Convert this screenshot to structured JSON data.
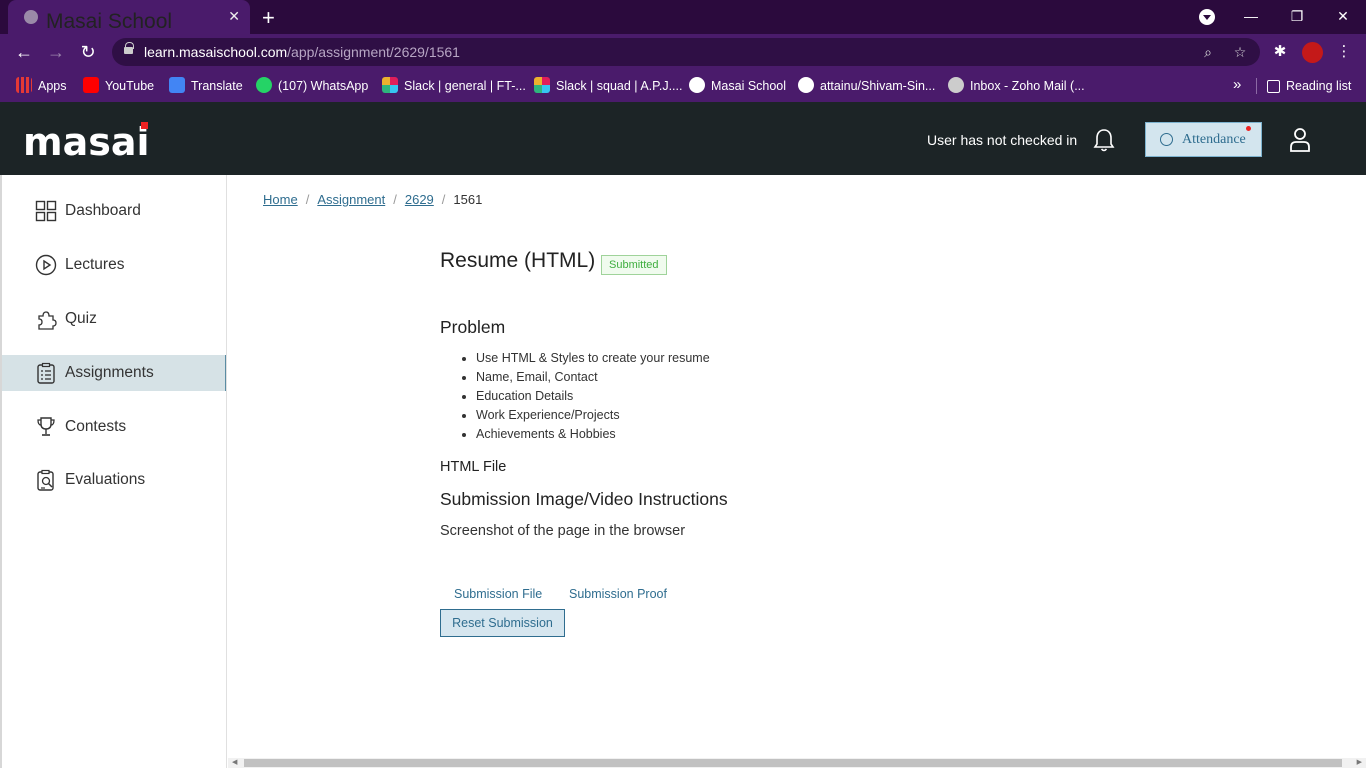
{
  "browser": {
    "tab_title": "Masai School",
    "url_host": "learn.masaischool.com",
    "url_path": "/app/assignment/2629/1561",
    "bookmarks": [
      {
        "label": "Apps",
        "color": "#e53935"
      },
      {
        "label": "YouTube",
        "color": "#ff0000"
      },
      {
        "label": "Translate",
        "color": "#4285f4"
      },
      {
        "label": "(107) WhatsApp",
        "color": "#25d366"
      },
      {
        "label": "Slack | general | FT-...",
        "color": "#e01e5a"
      },
      {
        "label": "Slack | squad | A.P.J....",
        "color": "#e01e5a"
      },
      {
        "label": "Masai School",
        "color": "#ffffff"
      },
      {
        "label": "attainu/Shivam-Sin...",
        "color": "#ffffff"
      },
      {
        "label": "Inbox - Zoho Mail (...",
        "color": "#cccccc"
      }
    ],
    "reading_list": "Reading list"
  },
  "header": {
    "logo": "masai",
    "checkin_status": "User has not checked in",
    "attendance_label": "Attendance"
  },
  "sidebar": {
    "items": [
      {
        "label": "Dashboard",
        "icon": "dashboard-icon"
      },
      {
        "label": "Lectures",
        "icon": "play-icon"
      },
      {
        "label": "Quiz",
        "icon": "puzzle-icon"
      },
      {
        "label": "Assignments",
        "icon": "clipboard-icon",
        "active": true
      },
      {
        "label": "Contests",
        "icon": "trophy-icon"
      },
      {
        "label": "Evaluations",
        "icon": "evaluation-icon"
      }
    ]
  },
  "breadcrumb": {
    "home": "Home",
    "assignment": "Assignment",
    "id": "2629",
    "current": "1561"
  },
  "assignment": {
    "title": "Resume (HTML)",
    "status": "Submitted",
    "problem_heading": "Problem",
    "problem_items": [
      "Use HTML & Styles to create your resume",
      "Name, Email, Contact",
      "Education Details",
      "Work Experience/Projects",
      "Achievements & Hobbies"
    ],
    "file_type": "HTML File",
    "submission_heading": "Submission Image/Video Instructions",
    "submission_instruction": "Screenshot of the page in the browser",
    "submission_file_link": "Submission File",
    "submission_proof_link": "Submission Proof",
    "reset_button": "Reset Submission"
  },
  "colors": {
    "accent": "#2f6d8f",
    "header_bg": "#1c2426",
    "success": "#3fae3f",
    "browser_chrome": "#4a1b6b"
  }
}
